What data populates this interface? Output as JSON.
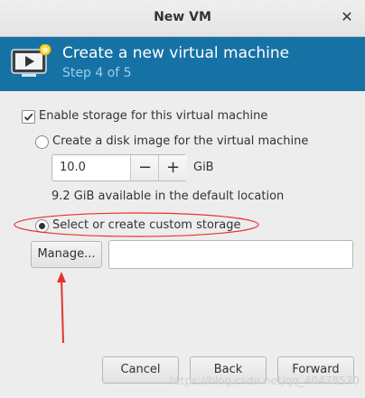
{
  "window": {
    "title": "New VM"
  },
  "banner": {
    "title": "Create a new virtual machine",
    "step": "Step 4 of 5"
  },
  "storage": {
    "enable_label": "Enable storage for this virtual machine",
    "enable_checked": true,
    "disk_image_label": "Create a disk image for the virtual machine",
    "size_value": "10.0",
    "size_unit": "GiB",
    "available_text": "9.2 GiB available in the default location",
    "custom_label": "Select or create custom storage",
    "selected_option": "custom",
    "manage_label": "Manage...",
    "custom_path_value": ""
  },
  "buttons": {
    "cancel": "Cancel",
    "back": "Back",
    "forward": "Forward"
  },
  "watermark": "https://blog.csdn.net/qq_40478570",
  "colors": {
    "banner": "#1672a5",
    "banner_subtitle": "#9ccfee",
    "annotation": "#e8322c"
  },
  "icons": {
    "close": "close-icon",
    "banner": "vm-monitor-icon",
    "spin_minus": "minus-icon",
    "spin_plus": "plus-icon"
  }
}
